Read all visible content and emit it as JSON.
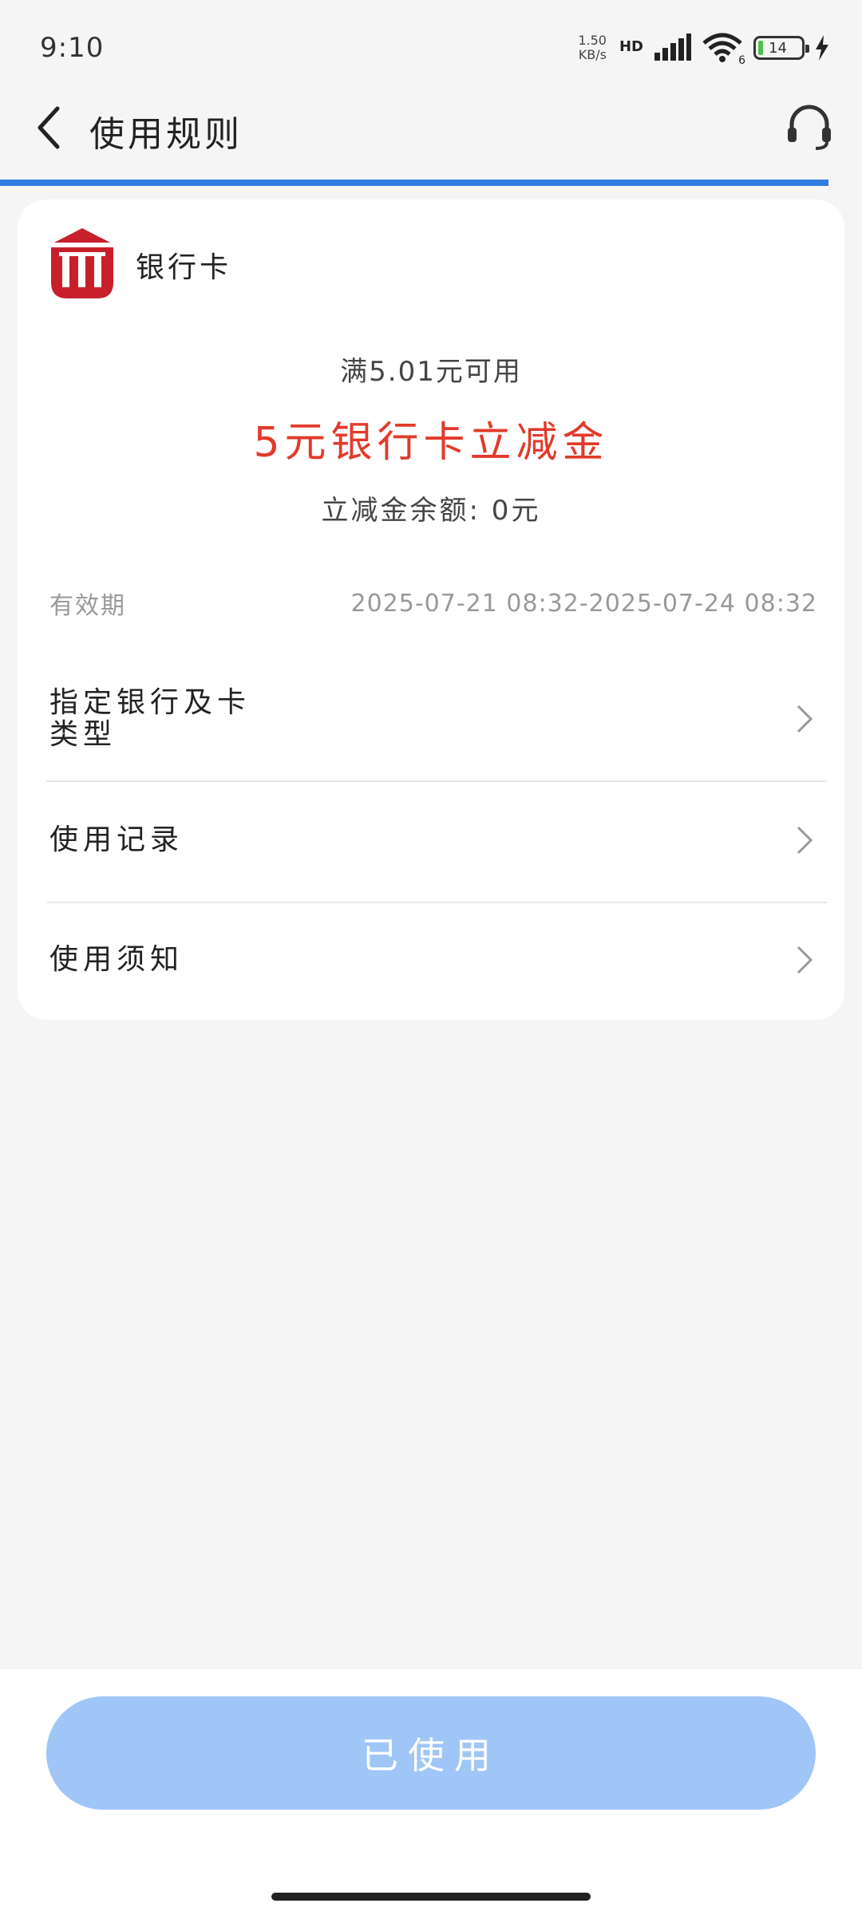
{
  "status_bar": {
    "time": "9:10",
    "net_speed_value": "1.50",
    "net_speed_unit": "KB/s",
    "hd": "HD",
    "wifi_badge": "6",
    "battery": "14"
  },
  "nav": {
    "title": "使用规则"
  },
  "card": {
    "bank_name": "银行卡",
    "condition": "满5.01元可用",
    "coupon_title": "5元银行卡立减金",
    "balance": "立减金余额: 0元",
    "validity_label": "有效期",
    "validity_value": "2025-07-21 08:32-2025-07-24 08:32",
    "menu": [
      {
        "label": "指定银行及卡类型"
      },
      {
        "label": "使用记录"
      },
      {
        "label": "使用须知"
      }
    ]
  },
  "bottom": {
    "button_label": "已使用"
  },
  "colors": {
    "accent_blue": "#2f7de1",
    "coupon_red": "#e23a2b",
    "logo_red": "#c8202b",
    "button_disabled": "#a0c6f8"
  }
}
